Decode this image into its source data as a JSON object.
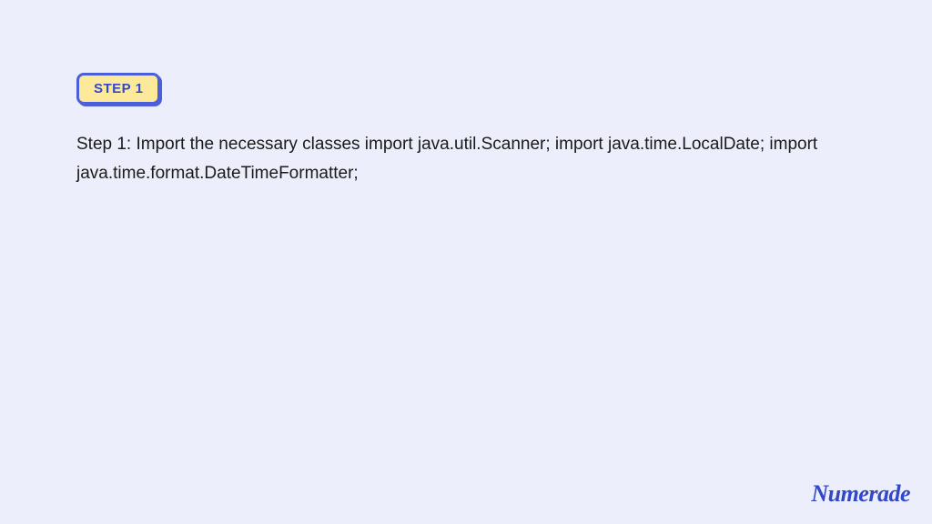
{
  "badge": {
    "label": "STEP 1"
  },
  "content": {
    "text": "Step 1: Import the necessary classes import java.util.Scanner; import java.time.LocalDate; import java.time.format.DateTimeFormatter;"
  },
  "branding": {
    "logo_text": "Numerade"
  }
}
